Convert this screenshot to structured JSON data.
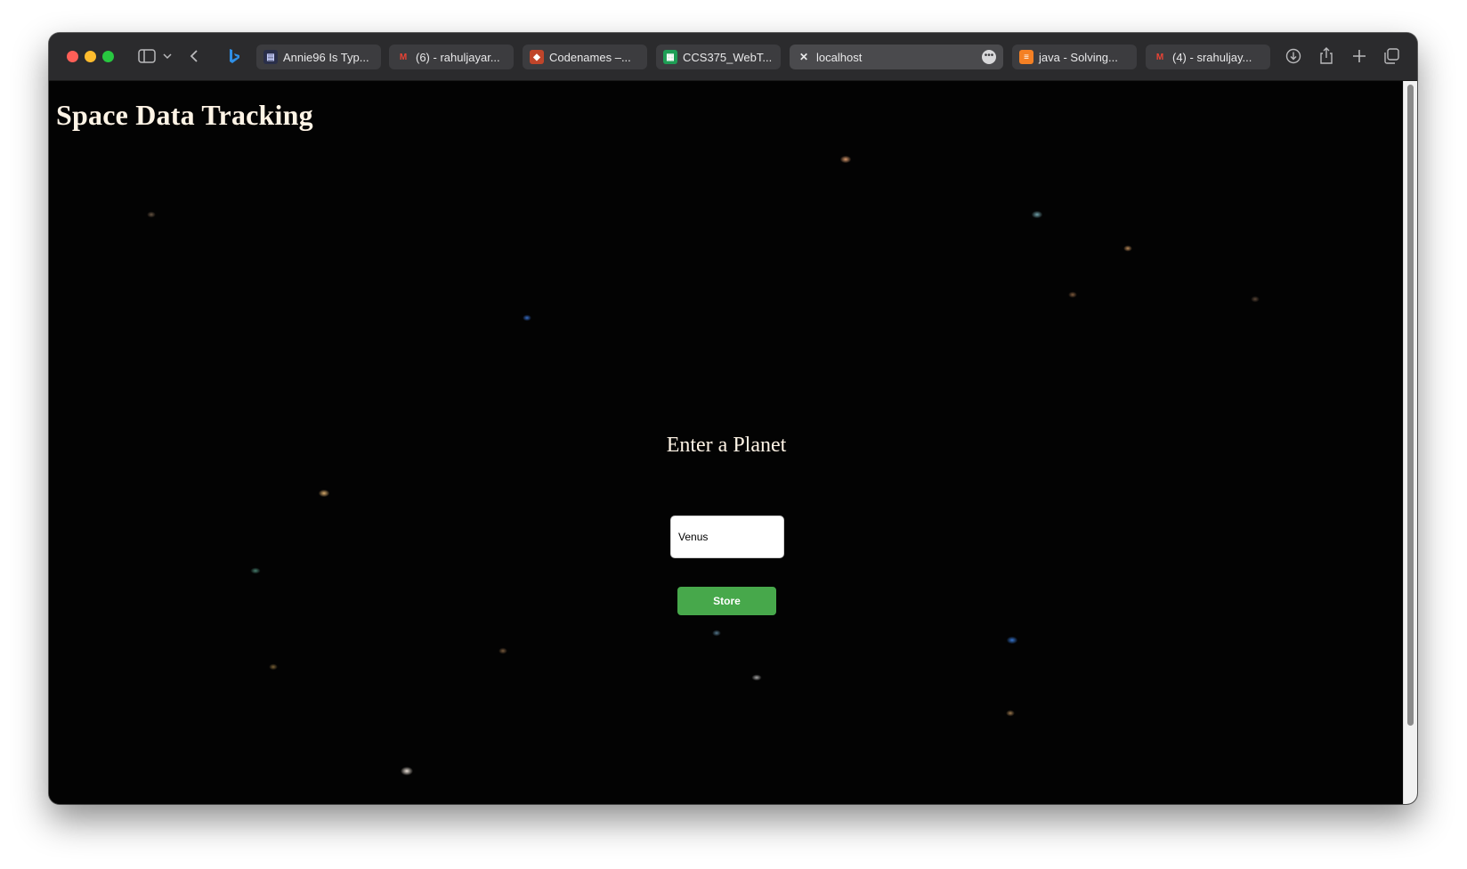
{
  "browser": {
    "tabs": [
      {
        "label": "Annie96 Is Typ...",
        "favicon": "document-icon",
        "active": false
      },
      {
        "label": "(6) - rahuljayar...",
        "favicon": "gmail-icon",
        "active": false
      },
      {
        "label": "Codenames –...",
        "favicon": "codenames-icon",
        "active": false
      },
      {
        "label": "CCS375_WebT...",
        "favicon": "sheets-icon",
        "active": false
      },
      {
        "label": "localhost",
        "favicon": "close-icon",
        "active": true
      },
      {
        "label": "java - Solving...",
        "favicon": "stackoverflow-icon",
        "active": false
      },
      {
        "label": "(4) - srahuljay...",
        "favicon": "gmail-icon",
        "active": false
      }
    ]
  },
  "page": {
    "title": "Space Data Tracking",
    "form_heading": "Enter a Planet",
    "planet_input_value": "Venus",
    "store_label": "Store"
  },
  "colors": {
    "title_text": "#fff4e6",
    "button_bg": "#47a84b",
    "page_bg": "#030303"
  }
}
